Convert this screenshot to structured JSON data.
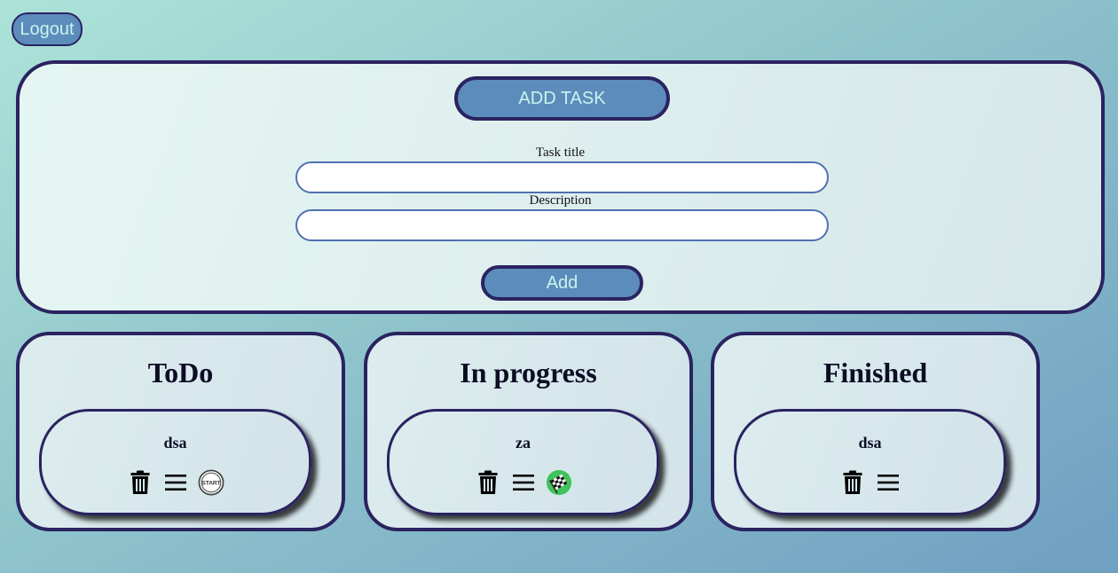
{
  "header": {
    "logout_label": "Logout"
  },
  "add_panel": {
    "add_task_label": "ADD TASK",
    "title_label": "Task title",
    "title_value": "",
    "description_label": "Description",
    "description_value": "",
    "submit_label": "Add"
  },
  "columns": [
    {
      "title": "ToDo",
      "tasks": [
        {
          "name": "dsa",
          "icons": [
            "trash-icon",
            "menu-icon",
            "start-icon"
          ]
        }
      ]
    },
    {
      "title": "In progress",
      "tasks": [
        {
          "name": "za",
          "icons": [
            "trash-icon",
            "menu-icon",
            "finish-flag-icon"
          ]
        }
      ]
    },
    {
      "title": "Finished",
      "tasks": [
        {
          "name": "dsa",
          "icons": [
            "trash-icon",
            "menu-icon"
          ]
        }
      ]
    }
  ],
  "start_icon_text": "START",
  "colors": {
    "accent": "#5c8cbc",
    "border": "#2a2360",
    "button_text": "#c9f4ec",
    "flag_green": "#3fc35a"
  }
}
